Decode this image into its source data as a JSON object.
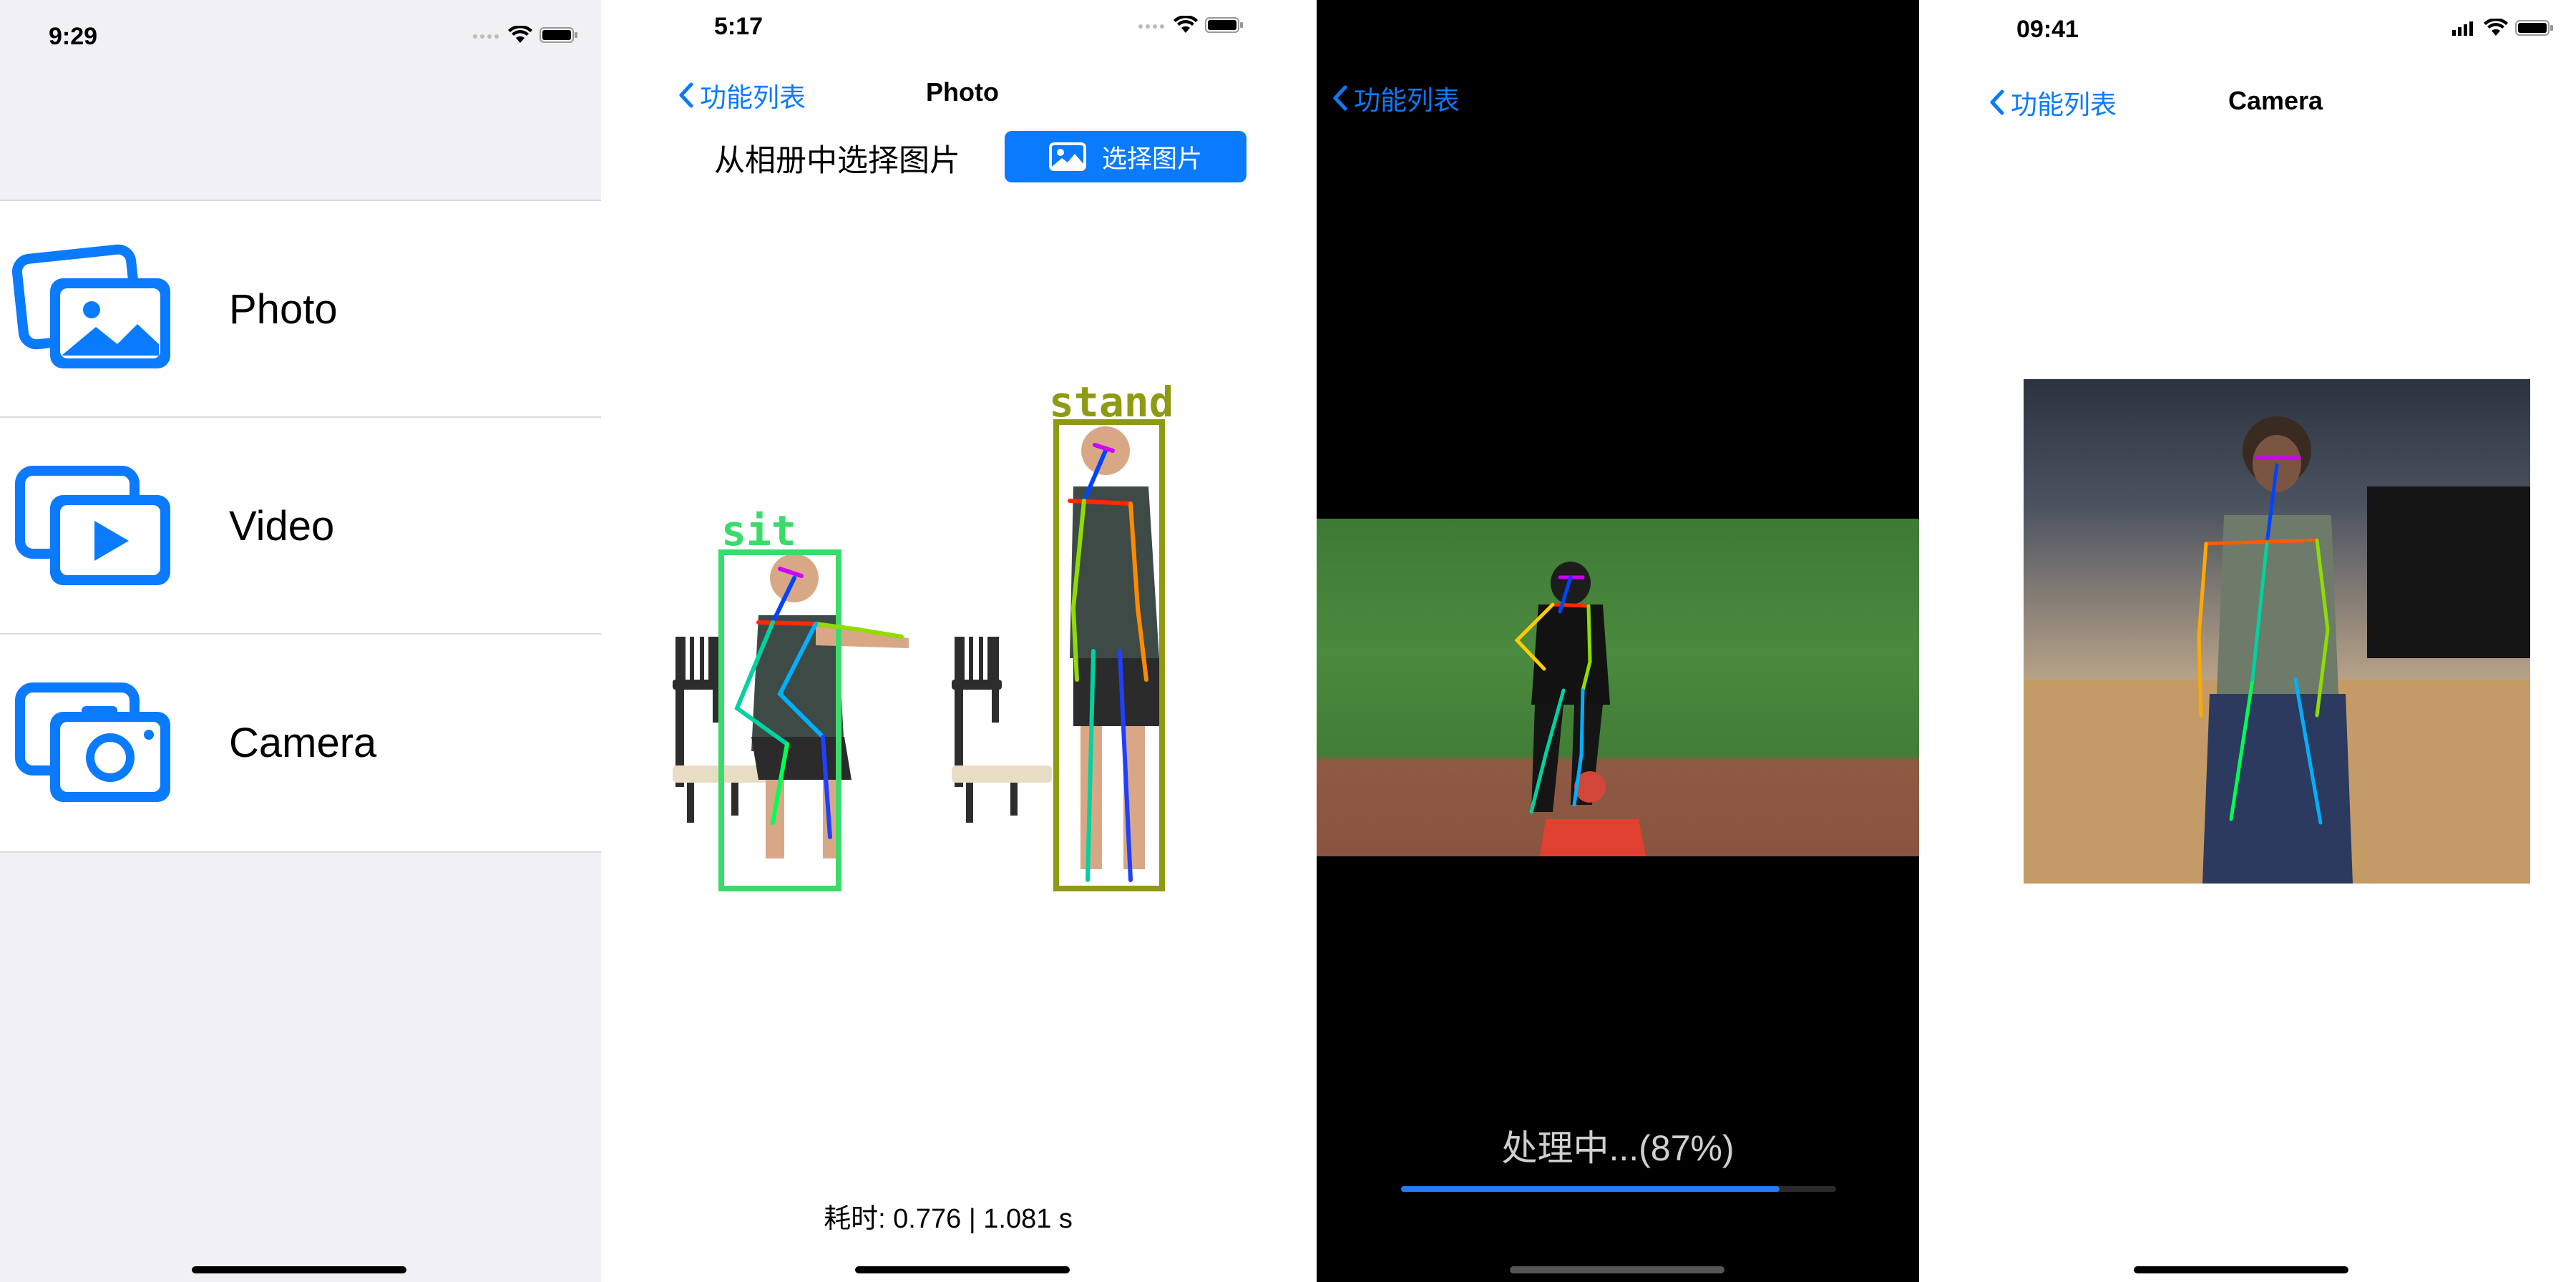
{
  "phone1": {
    "status_time": "9:29",
    "items": [
      {
        "label": "Photo",
        "icon": "photos-icon"
      },
      {
        "label": "Video",
        "icon": "video-icon"
      },
      {
        "label": "Camera",
        "icon": "camera-icon"
      }
    ]
  },
  "phone2": {
    "status_time": "5:17",
    "back_label": "功能列表",
    "title": "Photo",
    "pick_label": "从相册中选择图片",
    "pick_button": "选择图片",
    "pose_labels": [
      "sit",
      "stand"
    ],
    "timing": "耗时: 0.776 | 1.081 s"
  },
  "phone3": {
    "back_label": "功能列表",
    "progress_text": "处理中...(87%)",
    "progress": 0.87
  },
  "phone4": {
    "status_time": "09:41",
    "back_label": "功能列表",
    "title": "Camera"
  },
  "colors": {
    "accent": "#0a7aff",
    "sit_box": "#3adb6a",
    "stand_box": "#8f9a13"
  }
}
